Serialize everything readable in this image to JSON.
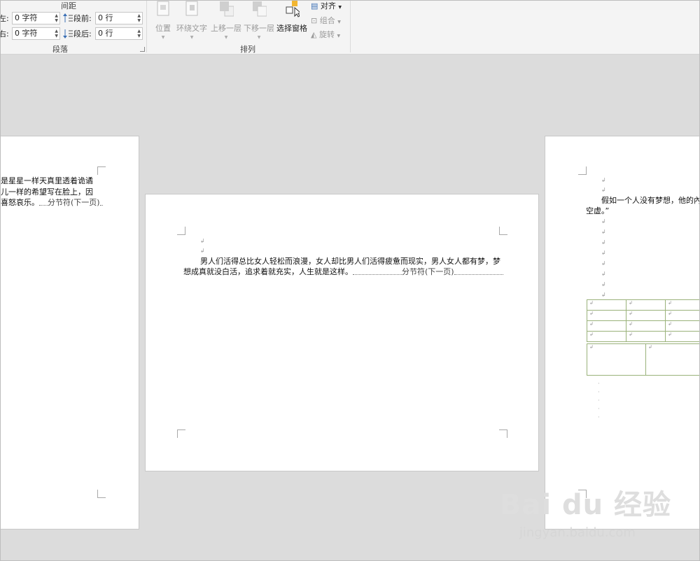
{
  "ribbon": {
    "spacing_label": "间距",
    "paragraph_group": "段落",
    "arrange_group": "排列",
    "indent_left_label": "左:",
    "indent_right_label": "右:",
    "indent_left_value": "0 字符",
    "indent_right_value": "0 字符",
    "space_before_label": "段前:",
    "space_after_label": "段后:",
    "space_before_value": "0 行",
    "space_after_value": "0 行",
    "position": "位置",
    "wrap_text": "环绕文字",
    "bring_forward": "上移一层",
    "send_backward": "下移一层",
    "selection_pane": "选择窗格",
    "align": "对齐",
    "group": "组合",
    "rotate": "旋转"
  },
  "pages": {
    "left": {
      "lines": [
        "是星星一样天真里透着诡谲",
        "儿一样的希望写在脸上，因",
        "喜怒哀乐。"
      ],
      "section_break": "分节符(下一页)"
    },
    "center": {
      "line1": "男人们活得总比女人轻松而浪漫，女人却比男人们活得疲惫而现实，男人女人都有梦，梦",
      "line2": "想成真就没白活，追求着就充实，人生就是这样。",
      "section_break": "分节符(下一页)"
    },
    "right": {
      "line1": "假如一个人没有梦想，他的內",
      "line2": "空虚。”"
    }
  },
  "watermark": {
    "logo_text": "Bai du 经验",
    "url": "jingyan.baidu.com"
  },
  "colors": {
    "ribbon_bg": "#f4f4f4",
    "workspace_bg": "#dcdcdc",
    "table_border": "#9ab27a"
  }
}
